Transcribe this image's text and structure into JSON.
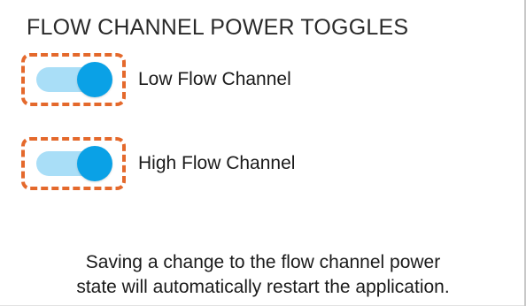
{
  "panel": {
    "title": "FLOW CHANNEL POWER TOGGLES"
  },
  "toggles": [
    {
      "label": "Low Flow Channel",
      "state": "on"
    },
    {
      "label": "High Flow Channel",
      "state": "on"
    }
  ],
  "notice": {
    "line1": "Saving a change to the flow channel power",
    "line2": "state will automatically restart the application."
  },
  "colors": {
    "highlight": "#e4692c",
    "thumb": "#0aa1e6",
    "track": "#a9def7"
  }
}
